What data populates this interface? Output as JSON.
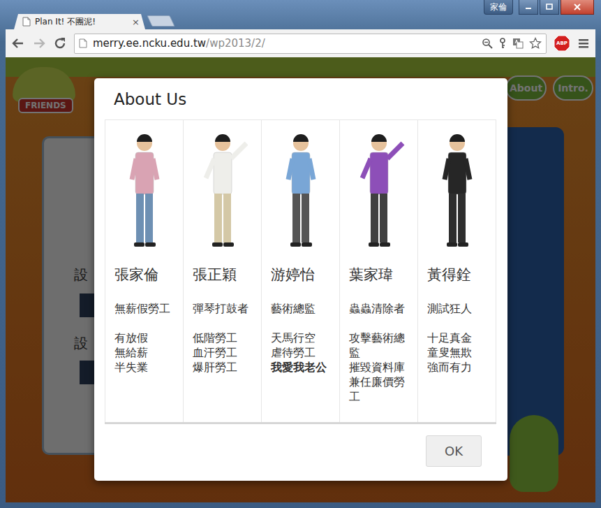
{
  "window": {
    "user": "家倫"
  },
  "tabs": [
    {
      "label": "Plan It! 不團泥!",
      "close": "×",
      "selected": true
    }
  ],
  "address_bar": {
    "host": "merry.ee.ncku.edu.tw",
    "path": "/wp2013/2/"
  },
  "extensions": [
    {
      "label": "ABP"
    }
  ],
  "page": {
    "logo": "FRIENDS",
    "nav": [
      "About",
      "Intro."
    ],
    "form_labels": [
      "設",
      "設"
    ]
  },
  "dialog": {
    "title": "About Us",
    "members": [
      {
        "name": "張家倫",
        "role": "無薪假勞工",
        "lines": [
          {
            "text": "有放假",
            "bold": false
          },
          {
            "text": "無給薪",
            "bold": false
          },
          {
            "text": "半失業",
            "bold": false
          }
        ]
      },
      {
        "name": "張正穎",
        "role": "彈琴打鼓者",
        "lines": [
          {
            "text": "低階勞工",
            "bold": false
          },
          {
            "text": "血汗勞工",
            "bold": false
          },
          {
            "text": "爆肝勞工",
            "bold": false
          }
        ]
      },
      {
        "name": "游婷怡",
        "role": "藝術總監",
        "lines": [
          {
            "text": "天馬行空",
            "bold": false
          },
          {
            "text": "虐待勞工",
            "bold": false
          },
          {
            "text": "我愛我老公",
            "bold": true
          }
        ]
      },
      {
        "name": "葉家瑋",
        "role": "蟲蟲清除者",
        "lines": [
          {
            "text": "攻擊藝術總監",
            "bold": false
          },
          {
            "text": "摧毀資料庫兼任廉價勞工",
            "bold": false
          }
        ]
      },
      {
        "name": "黃得銓",
        "role": "測試狂人",
        "lines": [
          {
            "text": "十足真金",
            "bold": false
          },
          {
            "text": "童叟無欺",
            "bold": false
          },
          {
            "text": "強而有力",
            "bold": false
          }
        ]
      }
    ],
    "buttons": [
      "OK"
    ]
  }
}
